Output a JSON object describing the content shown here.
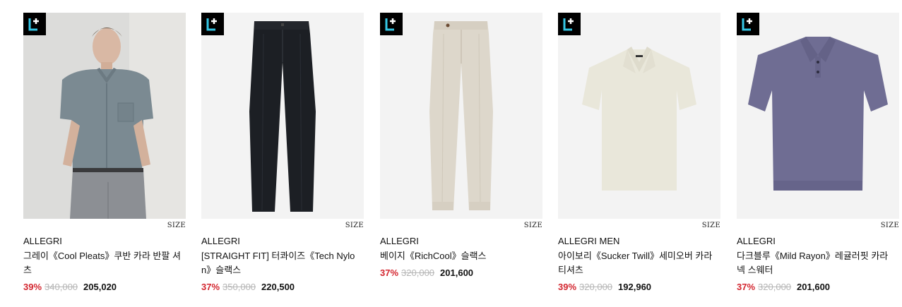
{
  "products": [
    {
      "badge": "L+",
      "size_label": "SIZE",
      "brand": "ALLEGRI",
      "name": "그레이《Cool Pleats》쿠반 카라 반팔 셔츠",
      "discount": "39%",
      "original_price": "340,000",
      "price": "205,020",
      "image_icon": "model-grey-shirt-image"
    },
    {
      "badge": "L+",
      "size_label": "SIZE",
      "brand": "ALLEGRI",
      "name": "[STRAIGHT FIT] 터콰이즈《Tech Nylon》슬랙스",
      "discount": "37%",
      "original_price": "350,000",
      "price": "220,500",
      "image_icon": "black-slacks-image"
    },
    {
      "badge": "L+",
      "size_label": "SIZE",
      "brand": "ALLEGRI",
      "name": "베이지《RichCool》슬랙스",
      "discount": "37%",
      "original_price": "320,000",
      "price": "201,600",
      "image_icon": "beige-slacks-image"
    },
    {
      "badge": "L+",
      "size_label": "SIZE",
      "brand": "ALLEGRI MEN",
      "name": "아이보리《Sucker Twill》세미오버 카라 티셔츠",
      "discount": "39%",
      "original_price": "320,000",
      "price": "192,960",
      "image_icon": "ivory-polo-image"
    },
    {
      "badge": "L+",
      "size_label": "SIZE",
      "brand": "ALLEGRI",
      "name": "다크블루《Mild Rayon》레귤러핏 카라넥 스웨터",
      "discount": "37%",
      "original_price": "320,000",
      "price": "201,600",
      "image_icon": "navy-polo-image"
    }
  ],
  "colors": {
    "badge_bg": "#000000",
    "badge_accent": "#35c7e6",
    "discount": "#d3262f",
    "original_price": "#b5b5b5"
  }
}
